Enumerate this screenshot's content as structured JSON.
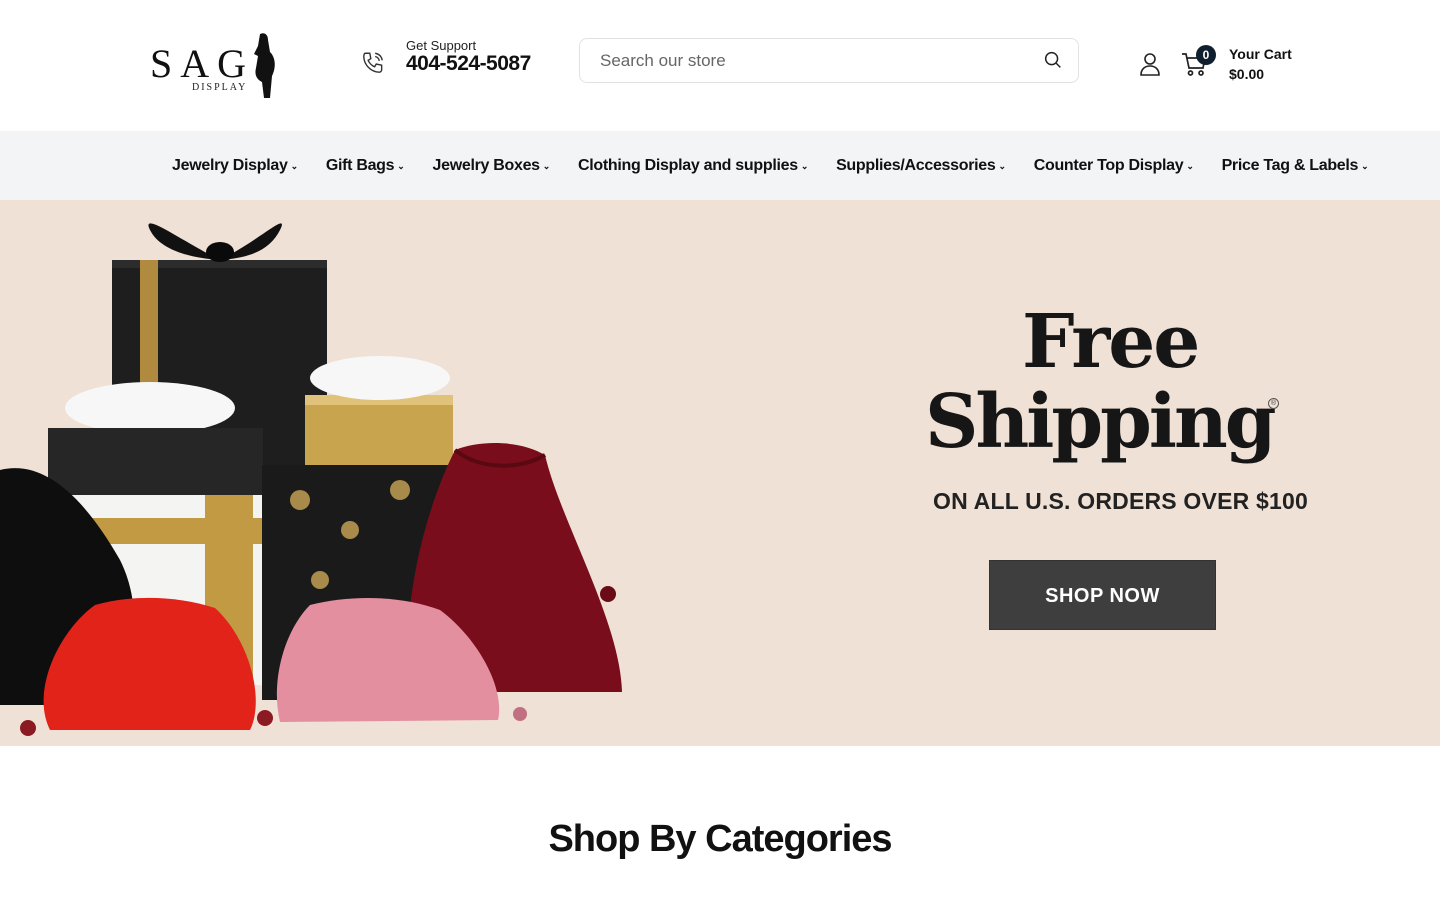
{
  "header": {
    "logo": {
      "text": "SAG",
      "sub": "DISPLAY"
    },
    "support": {
      "label": "Get Support",
      "phone": "404-524-5087"
    },
    "search": {
      "placeholder": "Search our store",
      "value": ""
    },
    "cart": {
      "count": "0",
      "label": "Your Cart",
      "total": "$0.00"
    }
  },
  "nav": {
    "items": [
      {
        "label": "Jewelry Display"
      },
      {
        "label": "Gift Bags"
      },
      {
        "label": "Jewelry Boxes"
      },
      {
        "label": "Clothing Display and supplies"
      },
      {
        "label": "Supplies/Accessories"
      },
      {
        "label": "Counter Top Display"
      },
      {
        "label": "Price Tag & Labels"
      }
    ]
  },
  "hero": {
    "headline_1": "Free",
    "headline_2": "Shipping",
    "subline": "ON ALL U.S. ORDERS OVER $100",
    "cta": "SHOP NOW",
    "background": "#efe1d5"
  },
  "section": {
    "title": "Shop By Categories"
  },
  "icons": [
    "phone-icon",
    "search-icon",
    "user-icon",
    "cart-icon",
    "chevron-down-icon"
  ]
}
